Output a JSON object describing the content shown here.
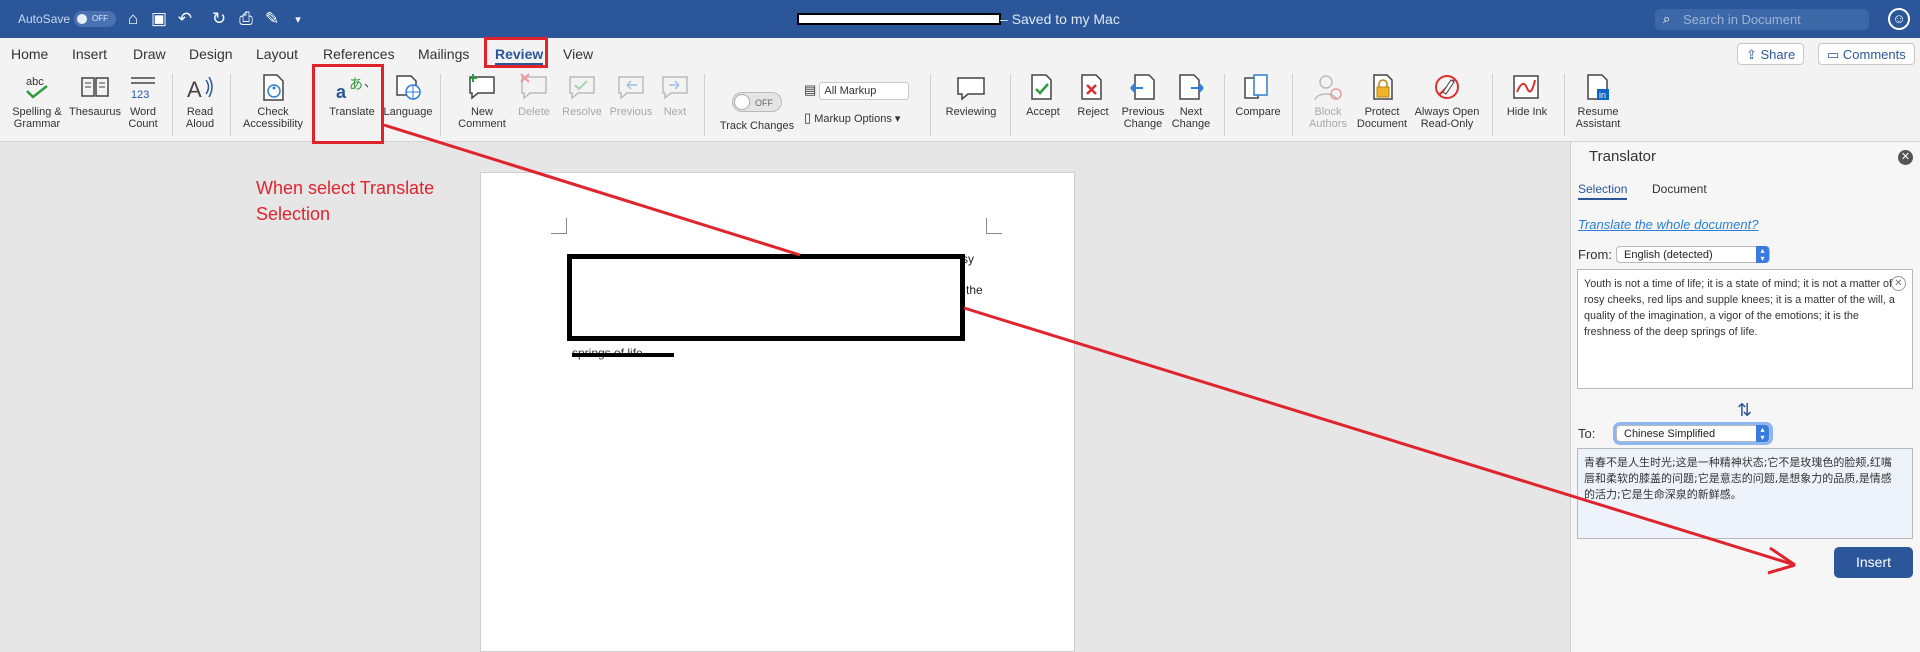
{
  "titlebar": {
    "autosave_label": "AutoSave",
    "autosave_state": "OFF",
    "document_status": "Saved to my Mac",
    "search_placeholder": "Search in Document"
  },
  "menu": {
    "tabs": [
      "Home",
      "Insert",
      "Draw",
      "Design",
      "Layout",
      "References",
      "Mailings",
      "Review",
      "View"
    ],
    "active_tab": "Review",
    "share_label": "Share",
    "comments_label": "Comments"
  },
  "ribbon": {
    "spelling": "Spelling &",
    "grammar": "Grammar",
    "thesaurus": "Thesaurus",
    "word": "Word",
    "count": "Count",
    "read": "Read",
    "aloud": "Aloud",
    "check": "Check",
    "accessibility": "Accessibility",
    "translate": "Translate",
    "language": "Language",
    "new": "New",
    "comment": "Comment",
    "delete": "Delete",
    "resolve": "Resolve",
    "previous": "Previous",
    "next": "Next",
    "track_toggle": "OFF",
    "track_changes": "Track Changes",
    "all_markup": "All Markup",
    "markup_options": "Markup Options",
    "reviewing": "Reviewing",
    "accept": "Accept",
    "reject": "Reject",
    "previous_line1": "Previous",
    "previous_line2": "Change",
    "next_line1": "Next",
    "next_line2": "Change",
    "compare": "Compare",
    "block": "Block",
    "authors": "Authors",
    "protect": "Protect",
    "document": "Document",
    "always_open": "Always Open",
    "read_only": "Read-Only",
    "hide_ink": "Hide Ink",
    "resume": "Resume",
    "assistant": "Assistant"
  },
  "document": {
    "annotation_line1": "When select Translate",
    "annotation_line2": "Selection",
    "frag_sy": "sy",
    "frag_the": "the",
    "struck_text": "springs of life."
  },
  "translator": {
    "title": "Translator",
    "tab_selection": "Selection",
    "tab_document": "Document",
    "translate_whole_link": "Translate the whole document?",
    "from_label": "From:",
    "from_value": "English (detected)",
    "source_text": "Youth is not a time of life; it is a state of mind; it is not a matter of rosy cheeks, red lips and supple knees; it is a matter of the will, a quality of the imagination, a vigor of the emotions; it is the freshness of the deep springs of life.",
    "to_label": "To:",
    "to_value": "Chinese Simplified",
    "translated_text": "青春不是人生时光;这是一种精神状态;它不是玫瑰色的脸颊,红嘴唇和柔软的膝盖的问题;它是意志的问题,是想象力的品质,是情感的活力;它是生命深泉的新鲜感。",
    "insert_label": "Insert"
  },
  "colors": {
    "title_bar": "#2b579a",
    "annotation": "#e0242e",
    "insert_button": "#2b579a"
  }
}
